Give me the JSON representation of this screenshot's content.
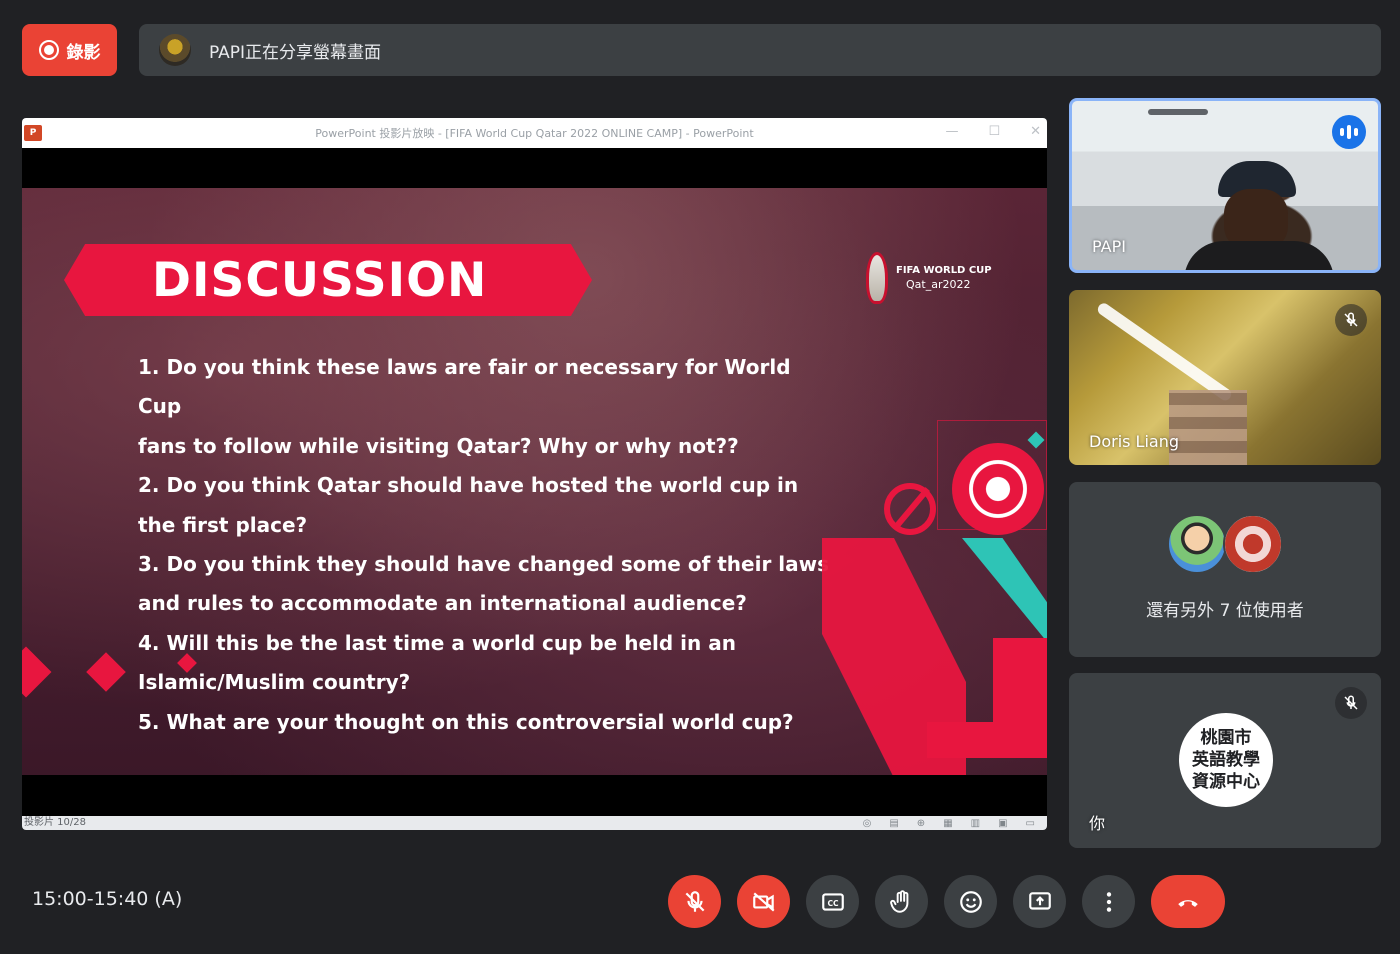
{
  "top_bar": {
    "record_label": "錄影",
    "share_text": "PAPI正在分享螢幕畫面"
  },
  "ppt": {
    "window_title": "PowerPoint 投影片放映 - [FIFA World Cup Qatar 2022 ONLINE CAMP] - PowerPoint",
    "status_text": "投影片 10/28"
  },
  "slide": {
    "heading": "DISCUSSION",
    "logo_line1": "FIFA WORLD CUP",
    "logo_line2": "Qat_ar2022",
    "lines": [
      "1. Do you think these laws are fair or necessary for World Cup",
      "fans to follow while visiting Qatar? Why or why not??",
      "2. Do you think Qatar should have hosted the world cup in",
      "the first place?",
      "3. Do you think they should have changed some of their laws",
      "and rules to accommodate an international audience?",
      "4. Will this be the last time a world cup be held in an",
      "Islamic/Muslim country?",
      "5. What are your thought on this controversial world cup?"
    ]
  },
  "participants": {
    "papi": {
      "name": "PAPI"
    },
    "doris": {
      "name": "Doris Liang"
    },
    "others": {
      "text": "還有另外 7 位使用者"
    },
    "you": {
      "name": "你",
      "avatar_lines": [
        "桃園市",
        "英語教學",
        "資源中心"
      ]
    }
  },
  "bottom_bar": {
    "meeting_time": "15:00-15:40 (A)",
    "controls": [
      "mic-off",
      "camera-off",
      "captions",
      "raise-hand",
      "emoji",
      "present-screen",
      "more-options",
      "leave-call"
    ]
  },
  "colors": {
    "background": "#202124",
    "panel": "#3c4043",
    "accent_red": "#ea4335",
    "speaking_blue": "#1a73e8",
    "slide_red": "#e8163f"
  }
}
